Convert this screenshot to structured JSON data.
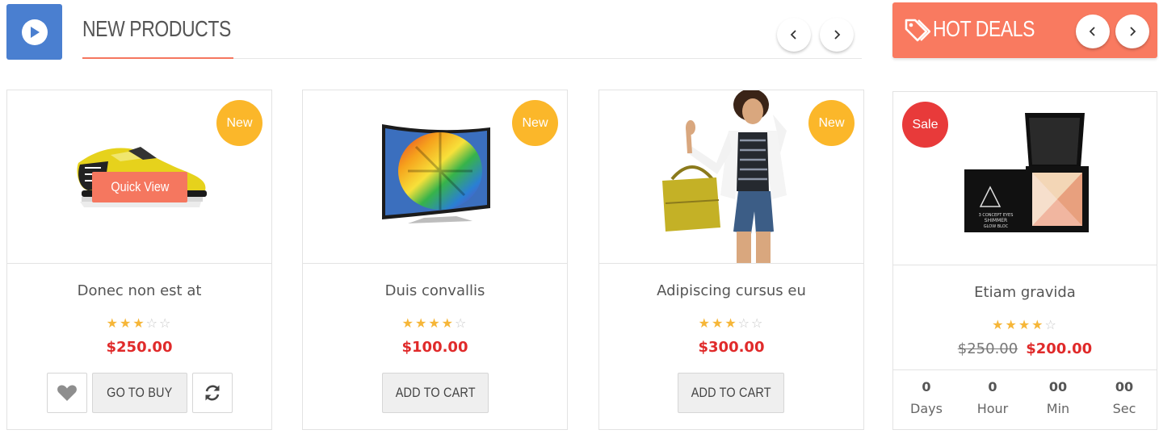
{
  "new_products": {
    "title": "NEW PRODUCTS",
    "prev_icon": "chevron-left-icon",
    "next_icon": "chevron-right-icon",
    "accent_color": "#f5775f",
    "play_color": "#4a7fd0"
  },
  "hot_deals": {
    "title": "HOT DEALS",
    "bar_color": "#f97a60",
    "tag_icon": "tags-icon"
  },
  "products": [
    {
      "name": "Donec non est at",
      "badge": "New",
      "price": "$250.00",
      "rating": 3,
      "rating_max": 5,
      "quick_view": "Quick View",
      "button": "GO TO BUY"
    },
    {
      "name": "Duis convallis",
      "badge": "New",
      "price": "$100.00",
      "rating": 4,
      "rating_max": 5,
      "button": "ADD TO CART"
    },
    {
      "name": "Adipiscing cursus eu",
      "badge": "New",
      "price": "$300.00",
      "rating": 3,
      "rating_max": 5,
      "button": "ADD TO CART"
    }
  ],
  "deal": {
    "name": "Etiam gravida",
    "badge": "Sale",
    "old_price": "$250.00",
    "price": "$200.00",
    "rating": 4,
    "rating_max": 5,
    "countdown": [
      {
        "value": "0",
        "label": "Days"
      },
      {
        "value": "0",
        "label": "Hour"
      },
      {
        "value": "00",
        "label": "Min"
      },
      {
        "value": "00",
        "label": "Sec"
      }
    ]
  }
}
